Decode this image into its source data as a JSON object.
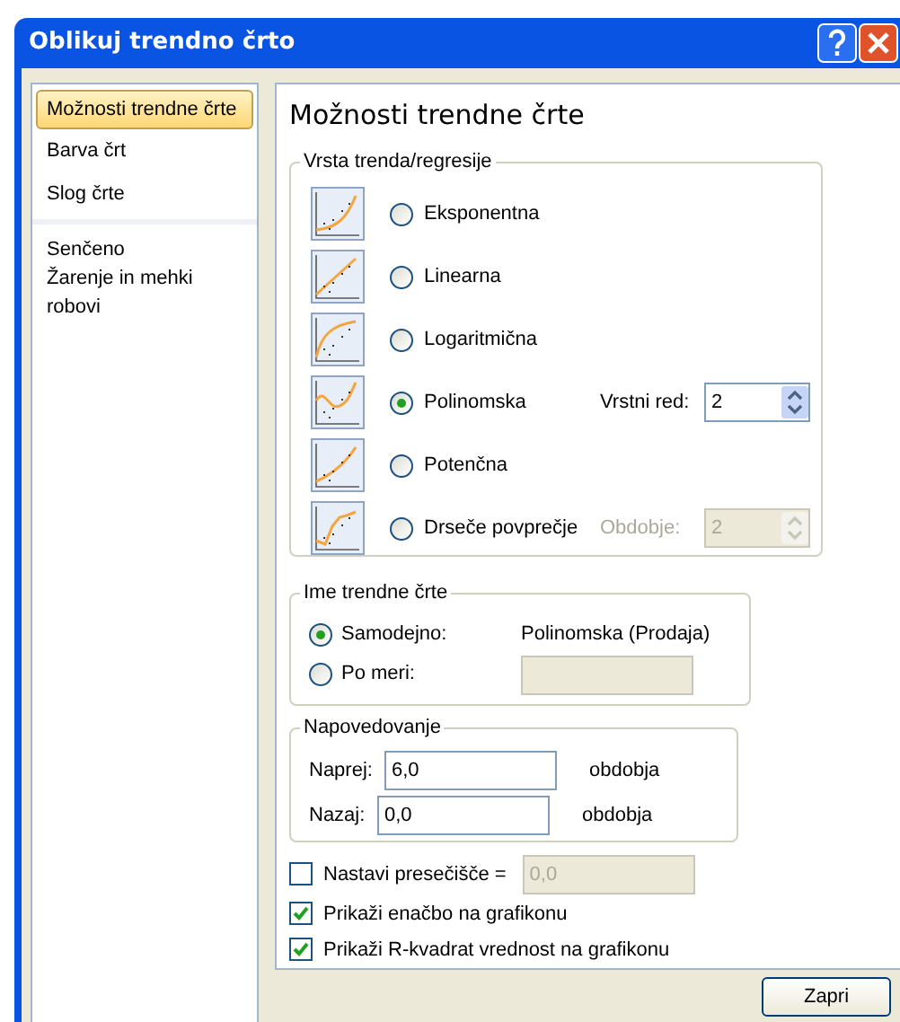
{
  "window": {
    "title": "Oblikuj trendno črto"
  },
  "sidebar": {
    "groups": [
      {
        "items": [
          {
            "label": "Možnosti trendne črte",
            "selected": true
          },
          {
            "label": "Barva črt",
            "selected": false
          },
          {
            "label": "Slog črte",
            "selected": false
          }
        ]
      },
      {
        "items": [
          {
            "label": "Senčeno",
            "selected": false
          },
          {
            "label": "Žarenje in mehki robovi",
            "selected": false
          }
        ]
      }
    ]
  },
  "panel": {
    "heading": "Možnosti trendne črte",
    "trend_type": {
      "legend": "Vrsta trenda/regresije",
      "options": [
        {
          "label": "Eksponentna",
          "kind": "exponential",
          "selected": false
        },
        {
          "label": "Linearna",
          "kind": "linear",
          "selected": false
        },
        {
          "label": "Logaritmična",
          "kind": "logarithmic",
          "selected": false
        },
        {
          "label": "Polinomska",
          "kind": "polynomial",
          "selected": true
        },
        {
          "label": "Potenčna",
          "kind": "power",
          "selected": false
        },
        {
          "label": "Drseče povprečje",
          "kind": "moving",
          "selected": false
        }
      ],
      "order": {
        "label": "Vrstni red:",
        "value": "2",
        "disabled": false
      },
      "period": {
        "label": "Obdobje:",
        "value": "2",
        "disabled": true
      }
    },
    "trend_name": {
      "legend": "Ime trendne črte",
      "options": [
        {
          "label": "Samodejno:",
          "selected": true,
          "value": "Polinomska (Prodaja)"
        },
        {
          "label": "Po meri:",
          "selected": false
        }
      ]
    },
    "forecast": {
      "legend": "Napovedovanje",
      "rows": [
        {
          "label": "Naprej:",
          "value": "6,0",
          "unit": "obdobja"
        },
        {
          "label": "Nazaj:",
          "value": "0,0",
          "unit": "obdobja"
        }
      ]
    },
    "checks": [
      {
        "label": "Nastavi presečišče =",
        "checked": false,
        "value": "0,0"
      },
      {
        "label": "Prikaži enačbo na grafikonu",
        "checked": true
      },
      {
        "label": "Prikaži R-kvadrat vrednost na grafikonu",
        "checked": true
      }
    ]
  },
  "buttons": [
    {
      "label": "Zapri"
    }
  ]
}
